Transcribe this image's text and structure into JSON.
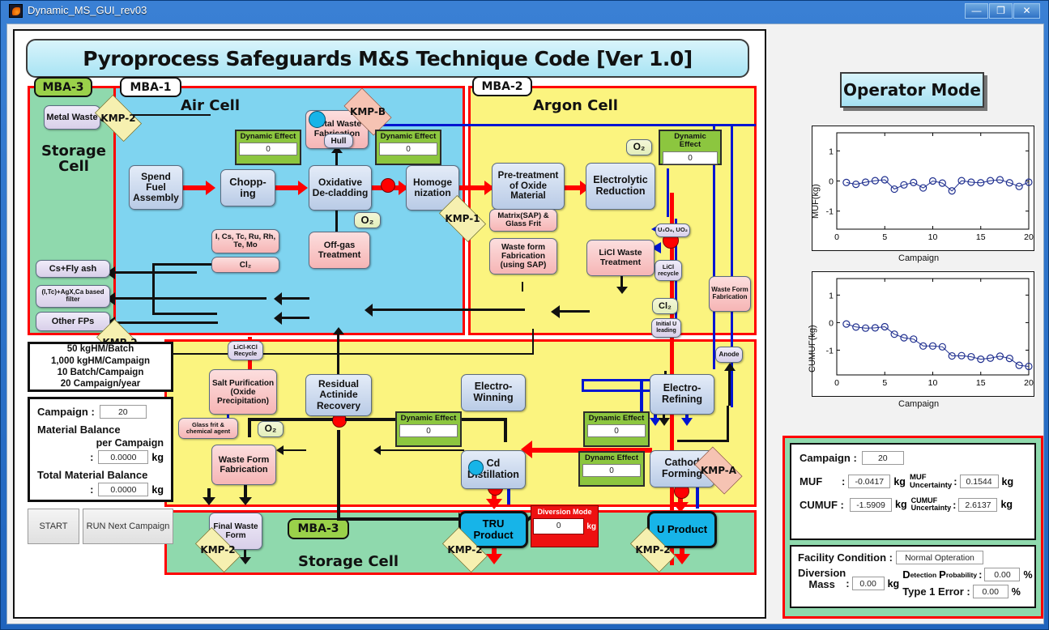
{
  "window": {
    "title": "Dynamic_MS_GUI_rev03",
    "minimize": "—",
    "maximize": "❐",
    "close": "✕"
  },
  "banner": {
    "title": "Pyroprocess Safeguards M&S Technique Code [Ver 1.0]"
  },
  "operator_mode": {
    "label": "Operator Mode"
  },
  "cells": {
    "storage_left": {
      "tag": "MBA-3",
      "title": "Storage Cell"
    },
    "air": {
      "tag": "MBA-1",
      "title": "Air Cell"
    },
    "argon": {
      "tag": "MBA-2",
      "title": "Argon Cell"
    },
    "storage_bottom": {
      "tag": "MBA-3",
      "title": "Storage Cell"
    }
  },
  "kmp": {
    "k1": "KMP-2",
    "k2": "KMP-B",
    "k3": "KMP-1",
    "k4": "KMP-2",
    "k5": "KMP-2",
    "k6": "KMP-2",
    "k7": "KMP-A",
    "k8": "KMP-2"
  },
  "boxes": {
    "metal_waste": "Metal Waste",
    "cs_fly_ash": "Cs+Fly ash",
    "agx_filter": "(I,Tc)+AgX,Ca based filter",
    "other_fps": "Other FPs",
    "final_waste_form_left": "Final Waste Form",
    "spend_fuel": "Spend Fuel Assembly",
    "chopping": "Chopp-ing",
    "oxidative": "Oxidative De-cladding",
    "homogenization": "Homoge nization",
    "metal_waste_fab": "Metal Waste Fabrication",
    "hull": "Hull",
    "o2_air": "O₂",
    "offgas": "Off-gas Treatment",
    "fp_list": "I, Cs, Tc, Ru, Rh, Te, Mo",
    "cl2_air": "Cl₂",
    "pretreat": "Pre-treatment of Oxide Material",
    "electro_reduction": "Electrolytic Reduction",
    "o2_argon": "O₂",
    "u3o8": "U₃O₈, UO₂",
    "licl_recycle": "LiCl recycle",
    "matrix_sap": "Matrix(SAP) & Glass Frit",
    "waste_form_sap": "Waste form Fabrication (using SAP)",
    "licl_waste": "LiCl Waste Treatment",
    "cl2_argon": "Cl₂",
    "initial_u": "Initial U leading",
    "waste_form_fab_right": "Waste Form Fabrication",
    "anode": "Anode",
    "licl_kcl_recycle": "LiCl-KCl Recycle",
    "salt_purification": "Salt Purification (Oxide Precipitation)",
    "glass_frit": "Glass frit & chemical agent",
    "o2_bottom": "O₂",
    "residual_actinide": "Residual Actinide Recovery",
    "electro_winning": "Electro-Winning",
    "cd_distillation": "Cd Distillation",
    "electro_refining": "Electro-Refining",
    "cathode_forming": "Cathod Forming",
    "waste_form_fab_bottom": "Waste Form Fabrication",
    "final_waste_form_bottom": "Final Waste Form",
    "tru_product": "TRU Product",
    "u_product": "U Product"
  },
  "dynamic_effects": {
    "label": "Dynamic Effect",
    "label_alt": "Dynamc Effect",
    "de1": "0",
    "de2": "0",
    "de3": "0",
    "de4": "0",
    "de5": "0",
    "de6": "0"
  },
  "diversion_mode": {
    "label": "Diversion Mode",
    "value": "0",
    "unit": "kg"
  },
  "spec": {
    "line1": "50 kgHM/Batch",
    "line2": "1,000 kgHM/Campaign",
    "line3": "10 Batch/Campaign",
    "line4": "20 Campaign/year"
  },
  "material_balance": {
    "campaign_label": "Campaign :",
    "campaign_value": "20",
    "mb_label": "Material Balance",
    "per_campaign": "per Campaign",
    "colon1": ":",
    "mb_value": "0.0000",
    "unit1": "kg",
    "total_label": "Total Material Balance",
    "colon2": ":",
    "total_value": "0.0000",
    "unit2": "kg"
  },
  "buttons": {
    "start": "START",
    "run_next": "RUN Next Campaign"
  },
  "results": {
    "campaign_label": "Campaign :",
    "campaign_value": "20",
    "muf_label": "MUF",
    "muf_colon": ":",
    "muf_value": "-0.0417",
    "muf_unit": "kg",
    "muf_unc_l1": "MUF",
    "muf_unc_l2": "Uncertainty",
    "muf_unc_colon": ":",
    "muf_unc_value": "0.1544",
    "muf_unc_unit": "kg",
    "cumuf_label": "CUMUF :",
    "cumuf_value": "-1.5909",
    "cumuf_unit": "kg",
    "cumuf_unc_l1": "CUMUF",
    "cumuf_unc_l2": "Uncertainty",
    "cumuf_unc_colon": ":",
    "cumuf_unc_value": "2.6137",
    "cumuf_unc_unit": "kg"
  },
  "facility": {
    "condition_label": "Facility Condition :",
    "condition_value": "Normal Opteration",
    "diversion_l1": "Diversion",
    "diversion_l2": "Mass",
    "diversion_colon": ":",
    "diversion_value": "0.00",
    "diversion_unit": "kg",
    "dp_label_big": "D",
    "dp_label_sub": "etection",
    "dp_label_big2": "P",
    "dp_label_sub2": "robability",
    "dp_colon": ":",
    "dp_value": "0.00",
    "dp_unit": "%",
    "t1_label": "Type 1 Error :",
    "t1_value": "0.00",
    "t1_unit": "%"
  },
  "colors": {
    "red": "#ff0000",
    "blue": "#0015d1",
    "air_cell": "#7fd4f0",
    "argon_cell": "#fbf47f",
    "storage_cell": "#8fd9ad",
    "accent_green": "#9ad14a",
    "plot_line": "#1f2f8f"
  },
  "chart_data": [
    {
      "type": "line",
      "title": "",
      "xlabel": "Campaign",
      "ylabel": "MUF(kg)",
      "xlim": [
        0,
        20
      ],
      "ylim": [
        -1.6,
        1.6
      ],
      "xticks": [
        0,
        5,
        10,
        15,
        20
      ],
      "yticks": [
        -1,
        0,
        1
      ],
      "grid": false,
      "marker": "o",
      "x": [
        1,
        2,
        3,
        4,
        5,
        6,
        7,
        8,
        9,
        10,
        11,
        12,
        13,
        14,
        15,
        16,
        17,
        18,
        19,
        20
      ],
      "values": [
        -0.05,
        -0.11,
        -0.04,
        0.01,
        0.04,
        -0.27,
        -0.13,
        -0.05,
        -0.23,
        0.0,
        -0.07,
        -0.33,
        0.01,
        -0.04,
        -0.06,
        0.01,
        0.04,
        -0.06,
        -0.18,
        -0.04
      ]
    },
    {
      "type": "line",
      "title": "",
      "xlabel": "Campaign",
      "ylabel": "CUMUF(kg)",
      "xlim": [
        0,
        20
      ],
      "ylim": [
        -1.9,
        1.6
      ],
      "xticks": [
        0,
        5,
        10,
        15,
        20
      ],
      "yticks": [
        -1,
        0,
        1
      ],
      "grid": false,
      "marker": "o",
      "x": [
        1,
        2,
        3,
        4,
        5,
        6,
        7,
        8,
        9,
        10,
        11,
        12,
        13,
        14,
        15,
        16,
        17,
        18,
        19,
        20
      ],
      "values": [
        -0.05,
        -0.16,
        -0.2,
        -0.19,
        -0.15,
        -0.42,
        -0.55,
        -0.6,
        -0.85,
        -0.85,
        -0.88,
        -1.21,
        -1.2,
        -1.24,
        -1.33,
        -1.29,
        -1.22,
        -1.3,
        -1.55,
        -1.59
      ]
    }
  ]
}
